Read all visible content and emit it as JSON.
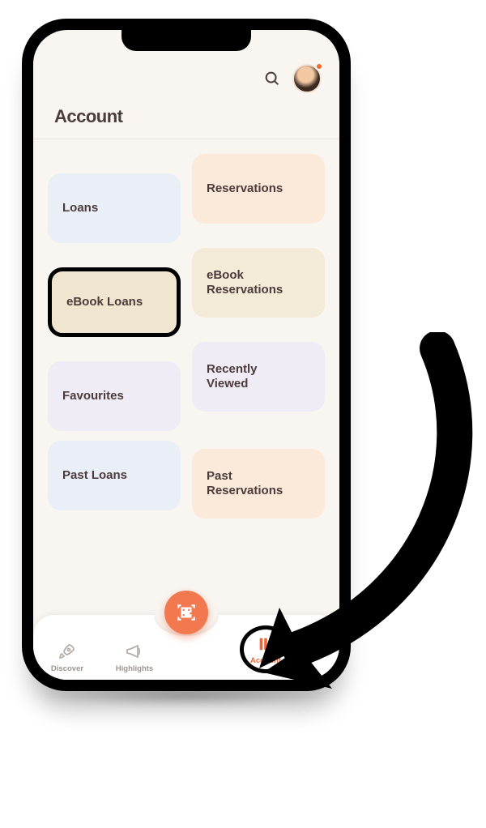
{
  "header": {
    "title": "Account"
  },
  "cards": {
    "left": [
      {
        "label": "Loans",
        "color": "blue",
        "highlighted": false
      },
      {
        "label": "eBook Loans",
        "color": "cream",
        "highlighted": true
      },
      {
        "label": "Favourites",
        "color": "lilac",
        "highlighted": false
      },
      {
        "label": "Past Loans",
        "color": "blue",
        "highlighted": false
      }
    ],
    "right": [
      {
        "label": "Reservations",
        "color": "orange",
        "highlighted": false
      },
      {
        "label": "eBook\nReservations",
        "color": "cream",
        "highlighted": false
      },
      {
        "label": "Recently\nViewed",
        "color": "lilac",
        "highlighted": false
      },
      {
        "label": "Past\nReservations",
        "color": "orange",
        "highlighted": false
      }
    ]
  },
  "nav": {
    "items": [
      {
        "icon": "rocket-icon",
        "label": "Discover",
        "active": false,
        "highlighted": false
      },
      {
        "icon": "megaphone-icon",
        "label": "Highlights",
        "active": false,
        "highlighted": false
      },
      {
        "icon": "books-icon",
        "label": "Account",
        "active": true,
        "highlighted": true
      }
    ],
    "fab_icon": "qr-icon"
  },
  "colors": {
    "accent": "#f2784f",
    "text": "#4b3b3a"
  }
}
